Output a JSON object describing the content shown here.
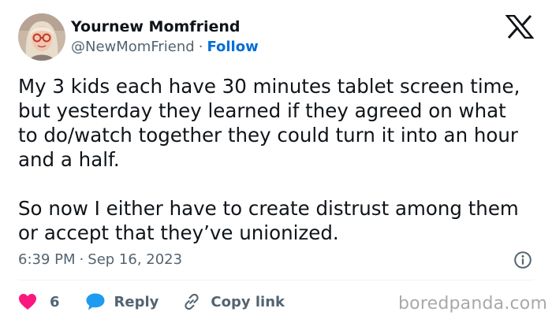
{
  "user": {
    "display_name": "Yournew Momfriend",
    "handle": "@NewMomFriend",
    "separator": "·",
    "follow_label": "Follow",
    "avatar_icon": "user-avatar-photo"
  },
  "brand": {
    "logo_icon": "x-logo-icon"
  },
  "tweet": {
    "text": "My 3 kids each have 30 minutes tablet screen time, but yesterday they learned if they agreed on what to do/watch together they could turn it into an hour and a half.\n\nSo now I either have to create distrust among them or accept that they’ve unionized.",
    "time": "6:39 PM",
    "separator": "·",
    "date": "Sep 16, 2023"
  },
  "actions": {
    "like_count": "6",
    "reply_label": "Reply",
    "copy_link_label": "Copy link"
  },
  "watermark": {
    "text": "boredpanda.com"
  },
  "colors": {
    "accent_blue": "#006fd6",
    "like_red": "#f91880",
    "reply_blue": "#1d9bf0",
    "secondary_text": "#536471",
    "primary_text": "#0f1419"
  }
}
